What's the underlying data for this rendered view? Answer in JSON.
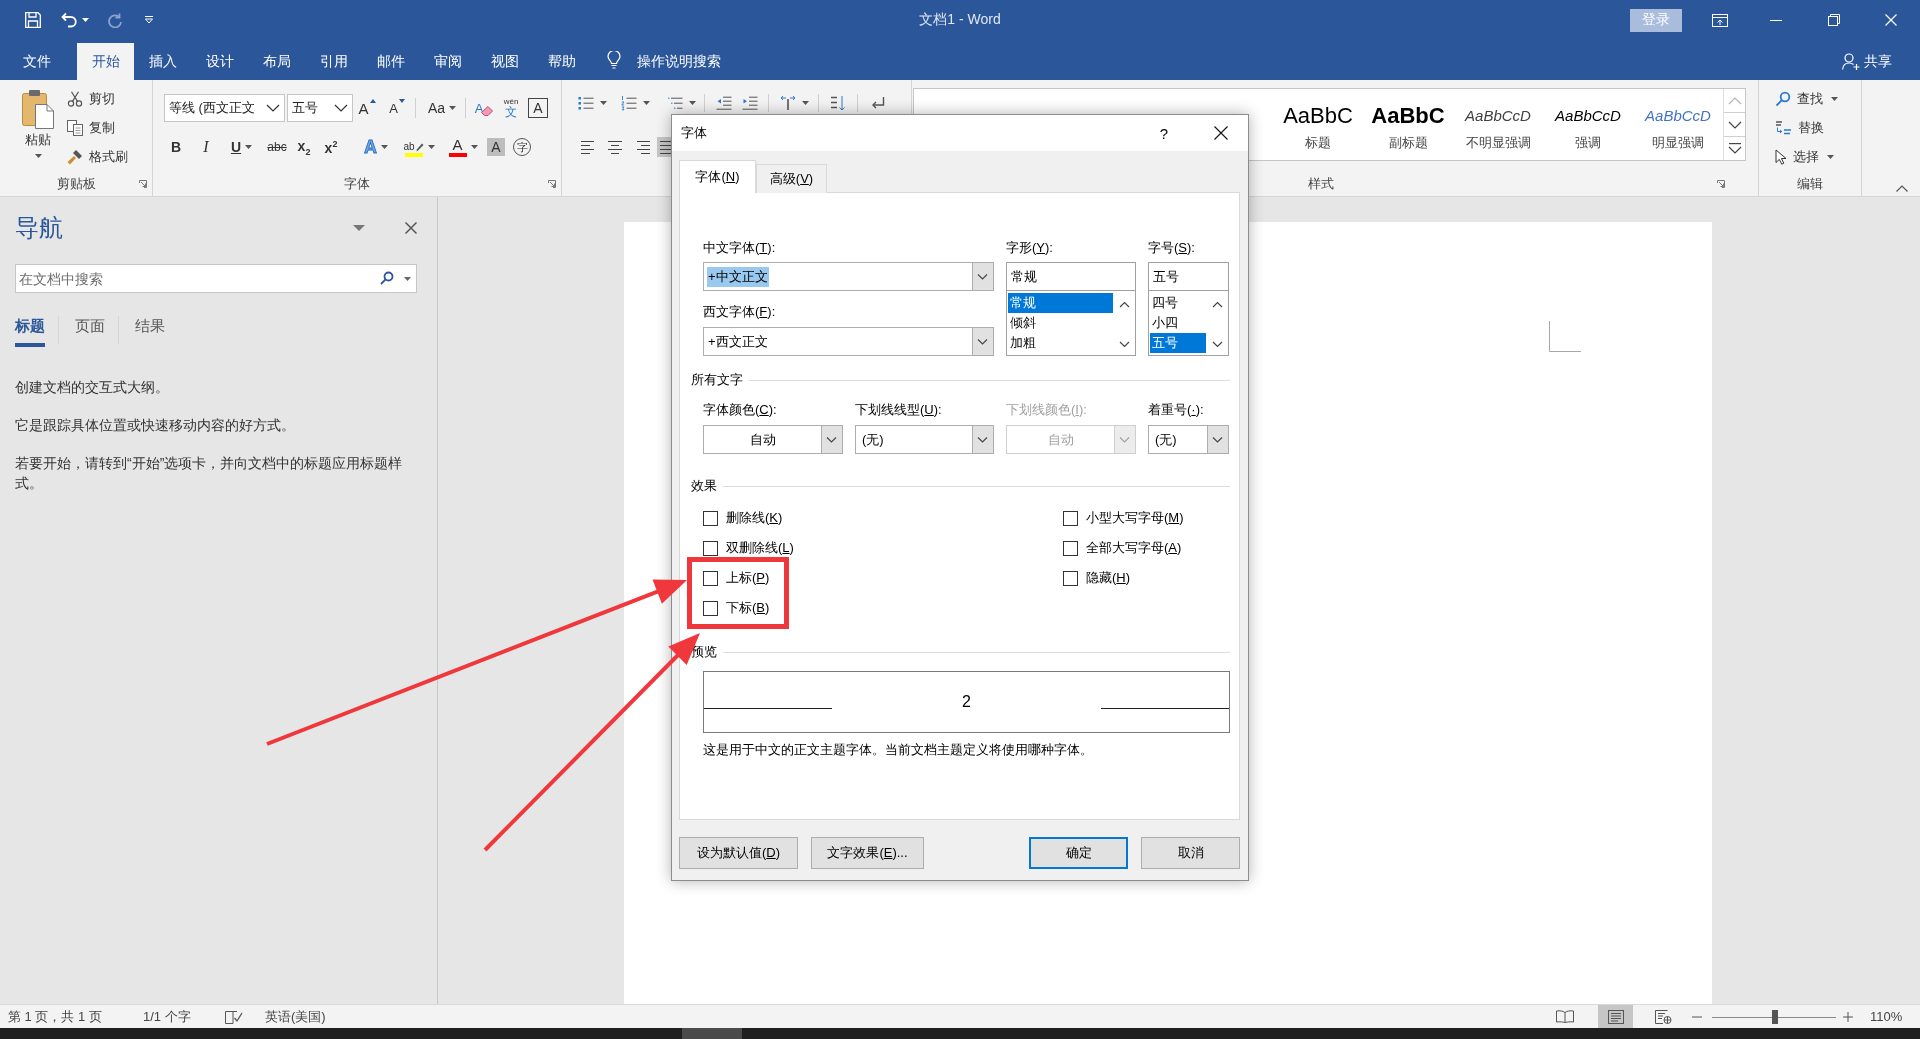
{
  "title_bar": {
    "quick_access": [
      {
        "kind": "save",
        "disabled": false
      },
      {
        "kind": "undo",
        "disabled": false
      },
      {
        "kind": "redo",
        "disabled": true
      },
      {
        "kind": "customize",
        "disabled": false
      }
    ],
    "title": "文档1 - Word",
    "sign_in": "登录"
  },
  "ribbon_tabs": [
    {
      "label": "文件",
      "selected": false
    },
    {
      "label": "开始",
      "selected": true
    },
    {
      "label": "插入",
      "selected": false
    },
    {
      "label": "设计",
      "selected": false
    },
    {
      "label": "布局",
      "selected": false
    },
    {
      "label": "引用",
      "selected": false
    },
    {
      "label": "邮件",
      "selected": false
    },
    {
      "label": "审阅",
      "selected": false
    },
    {
      "label": "视图",
      "selected": false
    },
    {
      "label": "帮助",
      "selected": false
    }
  ],
  "tell_me": "操作说明搜索",
  "share": "共享",
  "clipboard": {
    "paste": "粘贴",
    "commands": [
      {
        "kind": "cut",
        "label": "剪切"
      },
      {
        "kind": "copy",
        "label": "复制"
      },
      {
        "kind": "format_painter",
        "label": "格式刷"
      }
    ],
    "label": "剪贴板"
  },
  "font": {
    "name": "等线 (西文正文",
    "size": "五号",
    "row1": [
      {
        "kind": "grow",
        "text": "A"
      },
      {
        "kind": "shrink",
        "text": "A"
      },
      {
        "kind": "case",
        "text": "Aa"
      },
      {
        "kind": "clear",
        "text": "A"
      },
      {
        "kind": "phonetic",
        "ruby": "wén",
        "text": "文"
      },
      {
        "kind": "border",
        "text": "A"
      }
    ],
    "row2": [
      {
        "kind": "bold",
        "text": "B"
      },
      {
        "kind": "italic",
        "text": "I"
      },
      {
        "kind": "underline",
        "text": "U"
      },
      {
        "kind": "strike",
        "text": "abc"
      },
      {
        "kind": "subscript",
        "text": "x$_{2}$"
      },
      {
        "kind": "superscript",
        "text": "x$^{2}$"
      },
      {
        "kind": "effects",
        "text": "A"
      },
      {
        "kind": "highlight",
        "text": "ab",
        "color": "#ffff00"
      },
      {
        "kind": "color",
        "text": "A",
        "color": "#ff0000"
      },
      {
        "kind": "shading",
        "text": "A"
      },
      {
        "kind": "enclose",
        "text": "字"
      }
    ],
    "label": "字体"
  },
  "paragraph": {
    "align": [
      {
        "kind": "left",
        "selected": false
      },
      {
        "kind": "center",
        "selected": false
      },
      {
        "kind": "right",
        "selected": false
      },
      {
        "kind": "justify",
        "selected": true
      }
    ]
  },
  "styles": {
    "items": [
      {
        "kind": "heading",
        "preview": "AaBbC",
        "name": "标题"
      },
      {
        "kind": "subtitle",
        "preview": "AaBbC",
        "name": "副标题"
      },
      {
        "kind": "subtle",
        "preview": "AaBbCcD",
        "name": "不明显强调"
      },
      {
        "kind": "emphasis",
        "preview": "AaBbCcD",
        "name": "强调"
      },
      {
        "kind": "intense",
        "preview": "AaBbCcD",
        "name": "明显强调"
      }
    ],
    "label": "样式"
  },
  "editing": {
    "commands": [
      {
        "kind": "find",
        "label": "查找",
        "dropdown": true
      },
      {
        "kind": "replace",
        "label": "替换",
        "dropdown": false
      },
      {
        "kind": "select",
        "label": "选择",
        "dropdown": true
      }
    ],
    "label": "编辑"
  },
  "navigation": {
    "title": "导航",
    "search": {
      "placeholder": "在文档中搜索"
    },
    "tabs": [
      {
        "label": "标题",
        "selected": true
      },
      {
        "label": "页面",
        "selected": false
      },
      {
        "label": "结果",
        "selected": false
      }
    ],
    "paragraphs": [
      "创建文档的交互式大纲。",
      "它是跟踪具体位置或快速移动内容的好方式。",
      "若要开始，请转到“开始”选项卡，并向文档中的标题应用标题样式。"
    ]
  },
  "font_dialog": {
    "title": "字体",
    "help": "?",
    "tabs": [
      {
        "text": "字体(",
        "key": "N",
        "after": ")",
        "selected": true
      },
      {
        "text": "高级(",
        "key": "V",
        "after": ")",
        "selected": false
      }
    ],
    "chinese_font": {
      "label": {
        "text": "中文字体(",
        "key": "T",
        "after": "):"
      },
      "value": "+中文正文",
      "value_selected": true
    },
    "western_font": {
      "label": {
        "text": "西文字体(",
        "key": "F",
        "after": "):"
      },
      "value": "+西文正文",
      "value_selected": false
    },
    "font_style": {
      "label": {
        "text": "字形(",
        "key": "Y",
        "after": "):"
      },
      "value": "常规",
      "options": [
        {
          "label": "常规",
          "selected": true
        },
        {
          "label": "倾斜",
          "selected": false
        },
        {
          "label": "加粗",
          "selected": false
        }
      ]
    },
    "font_size": {
      "label": {
        "text": "字号(",
        "key": "S",
        "after": "):"
      },
      "value": "五号",
      "options": [
        {
          "label": "四号",
          "selected": false
        },
        {
          "label": "小四",
          "selected": false
        },
        {
          "label": "五号",
          "selected": true
        }
      ]
    },
    "all_text": {
      "heading": "所有文字",
      "fields": [
        {
          "kind": "color",
          "label": {
            "text": "字体颜色(",
            "key": "C",
            "after": "):"
          },
          "value": "自动",
          "disabled": false
        },
        {
          "kind": "list",
          "label": {
            "text": "下划线线型(",
            "key": "U",
            "after": "):"
          },
          "value": "(无)",
          "disabled": false
        },
        {
          "kind": "color",
          "label": {
            "text": "下划线颜色(",
            "key": "I",
            "after": "):"
          },
          "value": "自动",
          "disabled": true
        },
        {
          "kind": "list",
          "label": {
            "text": "着重号(",
            "key": "·",
            "after": "):"
          },
          "value": "(无)",
          "disabled": false
        }
      ]
    },
    "effects": {
      "heading": "效果",
      "left": [
        {
          "text": "删除线(",
          "key": "K",
          "after": ")",
          "checked": false
        },
        {
          "text": "双删除线(",
          "key": "L",
          "after": ")",
          "checked": false
        },
        {
          "text": "上标(",
          "key": "P",
          "after": ")",
          "checked": false
        },
        {
          "text": "下标(",
          "key": "B",
          "after": ")",
          "checked": false
        }
      ],
      "right": [
        {
          "text": "小型大写字母(",
          "key": "M",
          "after": ")",
          "checked": false
        },
        {
          "text": "全部大写字母(",
          "key": "A",
          "after": ")",
          "checked": false
        },
        {
          "text": "隐藏(",
          "key": "H",
          "after": ")",
          "checked": false
        }
      ]
    },
    "preview": {
      "heading": "预览",
      "sample": "2",
      "description": "这是用于中文的正文主题字体。当前文档主题定义将使用哪种字体。"
    },
    "left_buttons": [
      {
        "text": "设为默认值(",
        "key": "D",
        "after": ")",
        "default": false
      },
      {
        "text": "文字效果(",
        "key": "E",
        "after": ")...",
        "default": false
      }
    ],
    "right_buttons": [
      {
        "text": "确定",
        "default": true
      },
      {
        "text": "取消",
        "default": false
      }
    ]
  },
  "status_bar": {
    "page": "第 1 页，共 1 页",
    "words": "1/1 个字",
    "language": "英语(美国)",
    "views": [
      {
        "kind": "read",
        "selected": false
      },
      {
        "kind": "print",
        "selected": true
      },
      {
        "kind": "web",
        "selected": false
      }
    ],
    "zoom": {
      "level": 0.51,
      "value": "110%"
    }
  }
}
